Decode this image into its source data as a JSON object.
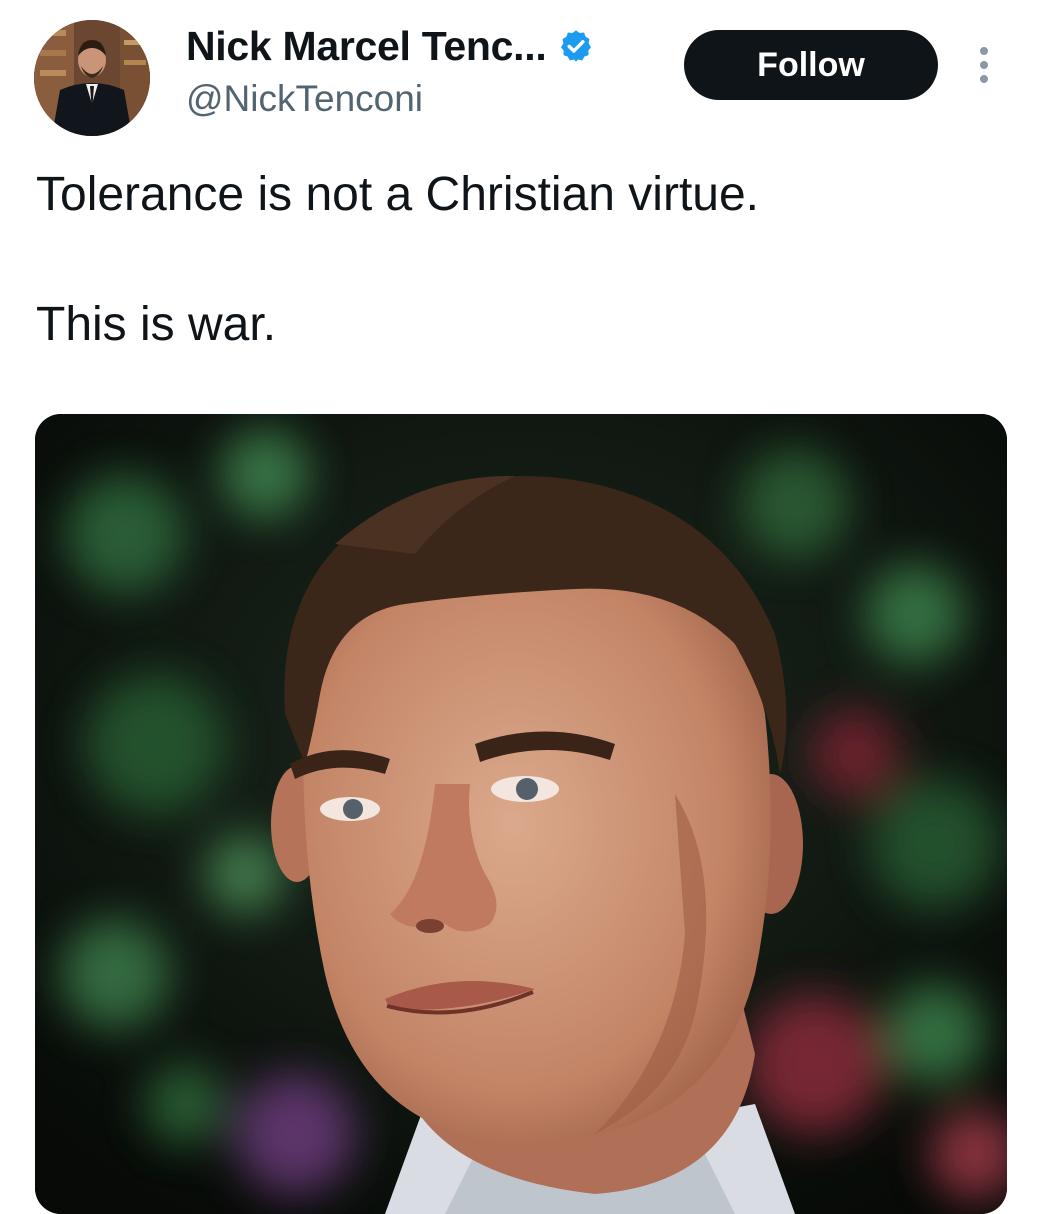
{
  "tweet": {
    "author": {
      "display_name": "Nick Marcel Tenc...",
      "handle": "@NickTenconi",
      "verified": true,
      "verified_icon": "verified-badge-icon",
      "avatar_icon": "avatar-photo"
    },
    "follow_label": "Follow",
    "more_icon": "more-options-icon",
    "text_lines": [
      "Tolerance is not a Christian virtue.",
      "This is war."
    ],
    "media": {
      "type": "photo",
      "icon": "media-photo"
    }
  },
  "colors": {
    "primary_text": "#0f1419",
    "secondary_text": "#536471",
    "follow_bg": "#0f1419",
    "follow_text": "#ffffff",
    "verified_blue": "#1d9bf0"
  }
}
